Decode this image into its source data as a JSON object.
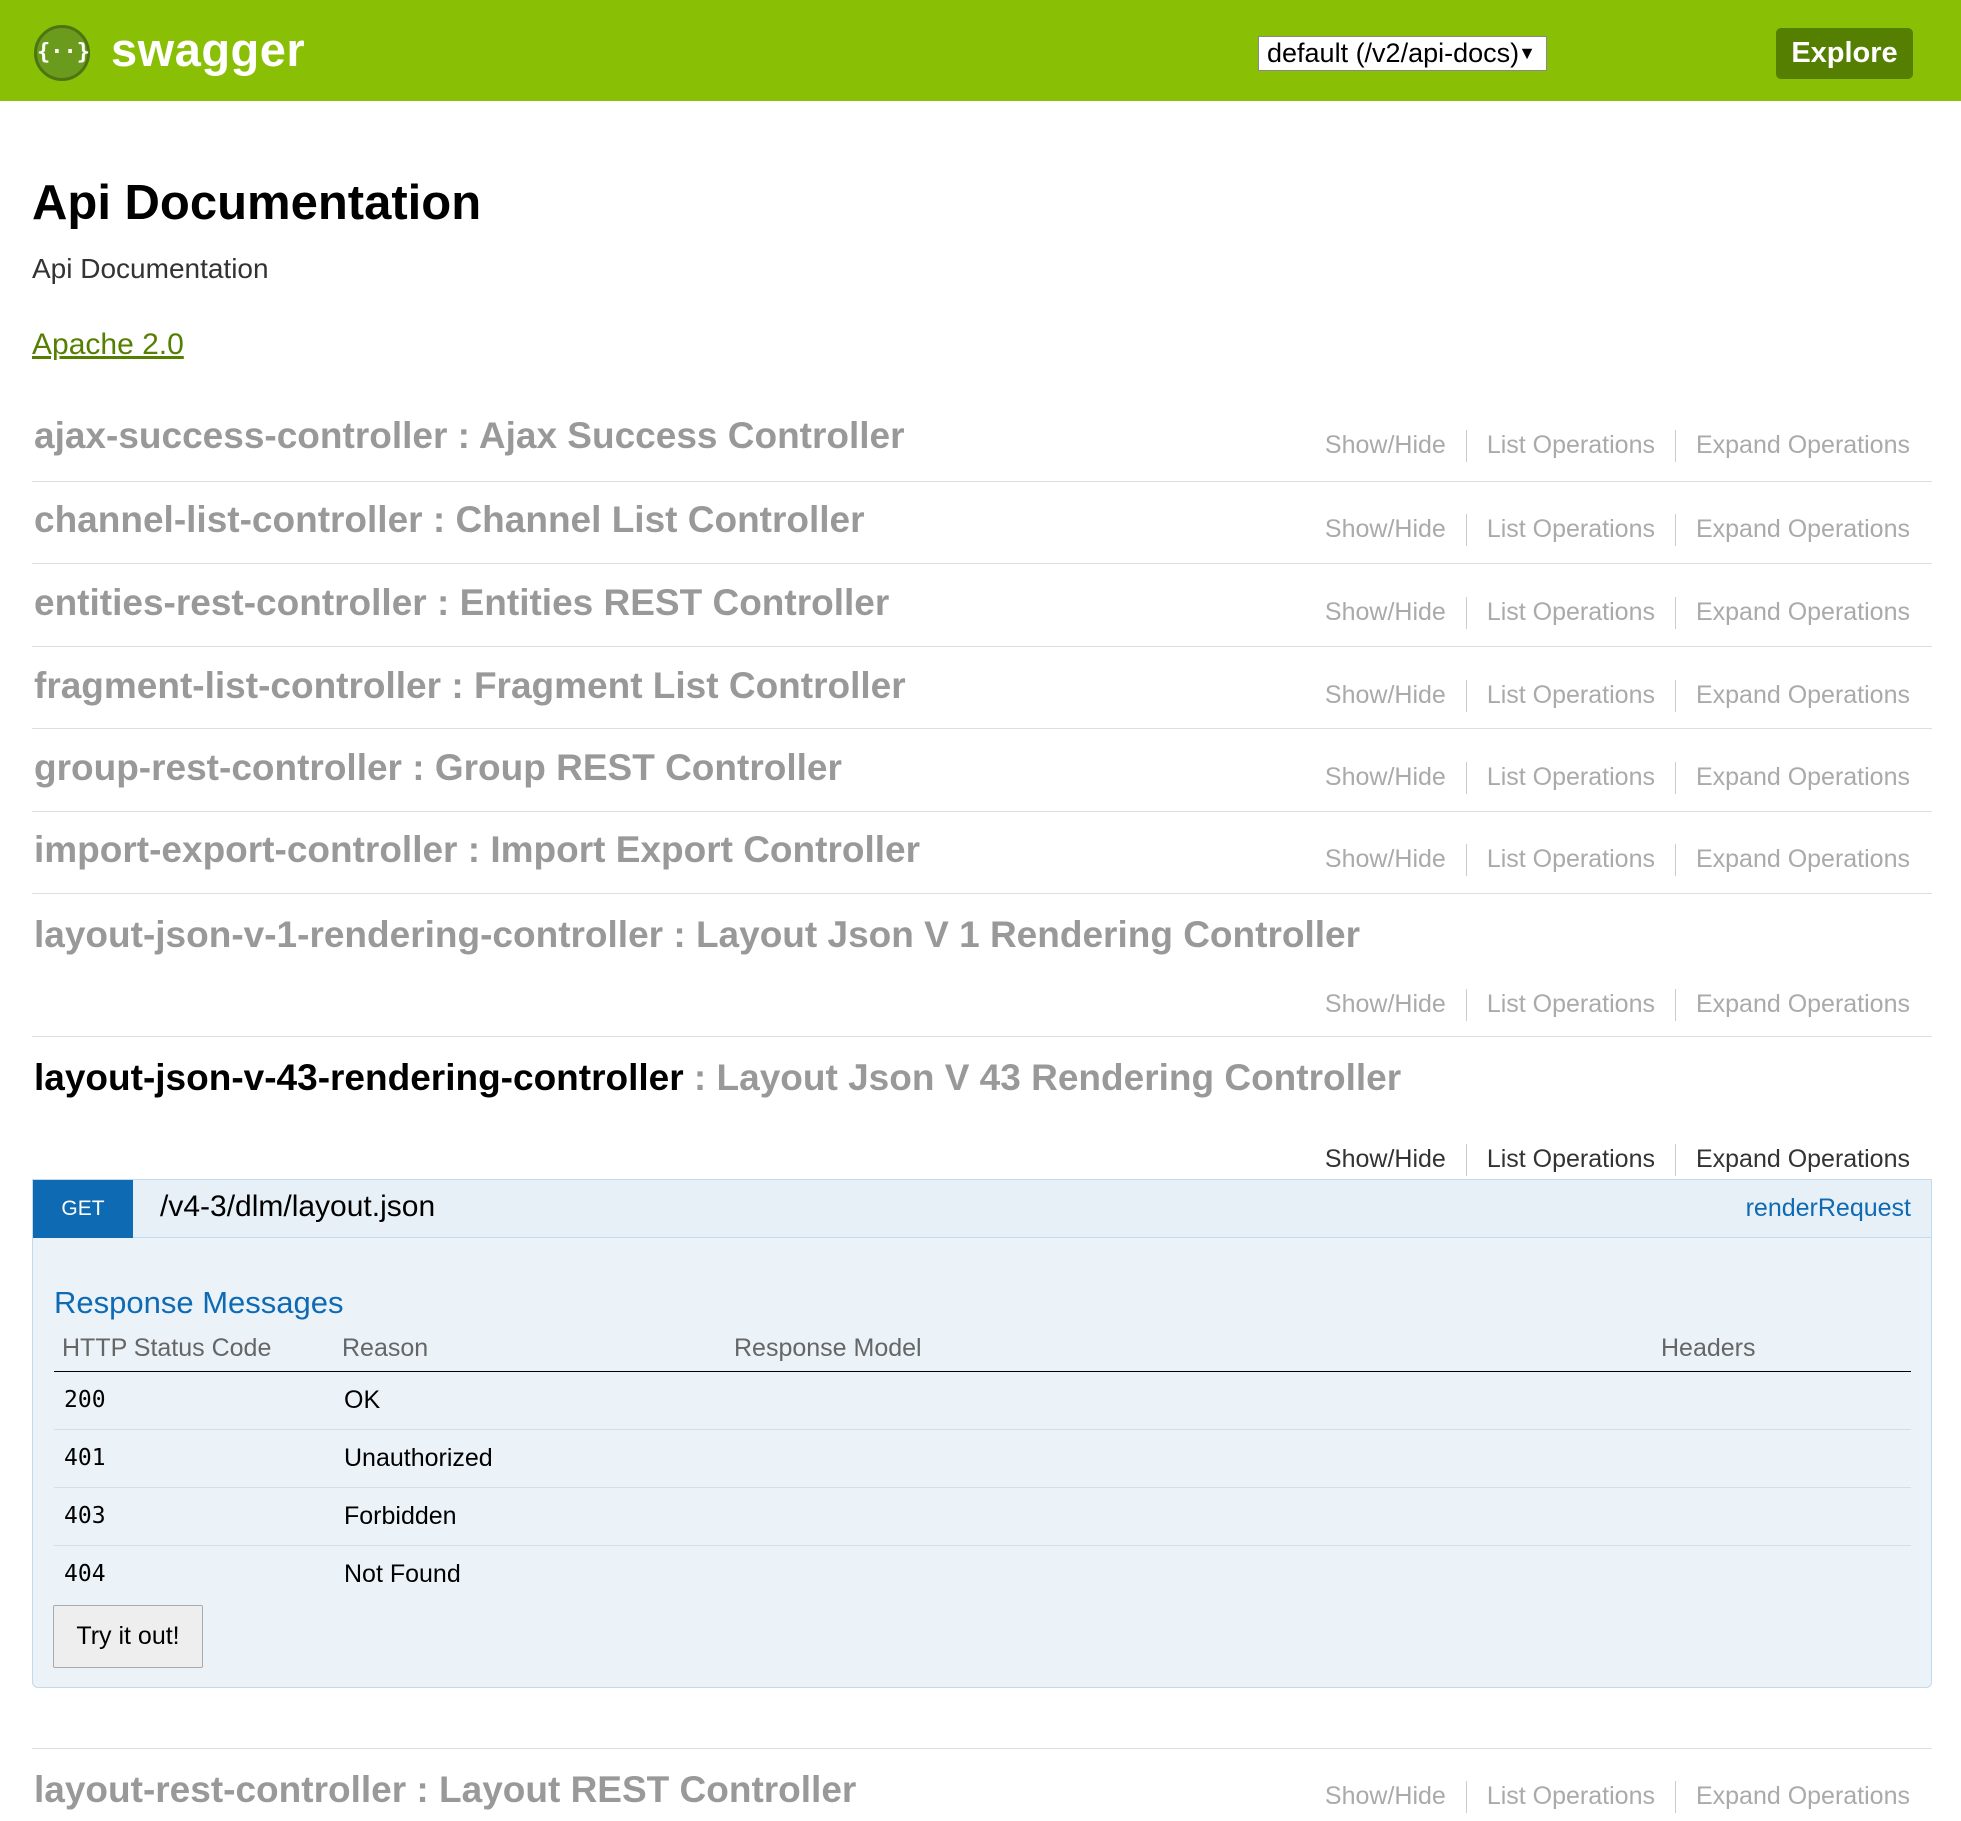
{
  "header": {
    "logo_glyph": "{··}",
    "logo_text": "swagger",
    "spec_select": "default (/v2/api-docs)",
    "spec_caret": "▼",
    "explore_label": "Explore",
    "bg_color": "#89bf04"
  },
  "info": {
    "title": "Api Documentation",
    "description": "Api Documentation",
    "license": "Apache 2.0"
  },
  "ops_labels": {
    "show_hide": "Show/Hide",
    "list_operations": "List Operations",
    "expand_operations": "Expand Operations"
  },
  "resources": [
    {
      "name": "ajax-success-controller",
      "sep": " : ",
      "desc": "Ajax Success Controller"
    },
    {
      "name": "channel-list-controller",
      "sep": " : ",
      "desc": "Channel List Controller"
    },
    {
      "name": "entities-rest-controller",
      "sep": " : ",
      "desc": "Entities REST Controller"
    },
    {
      "name": "fragment-list-controller",
      "sep": " : ",
      "desc": "Fragment List Controller"
    },
    {
      "name": "group-rest-controller",
      "sep": " : ",
      "desc": "Group REST Controller"
    },
    {
      "name": "import-export-controller",
      "sep": " : ",
      "desc": "Import Export Controller"
    },
    {
      "name": "layout-json-v-1-rendering-controller",
      "sep": " : ",
      "desc": "Layout Json V 1 Rendering Controller"
    },
    {
      "name": "layout-json-v-43-rendering-controller",
      "sep": " : ",
      "desc": "Layout Json V 43 Rendering Controller"
    },
    {
      "name": "layout-rest-controller",
      "sep": " : ",
      "desc": "Layout REST Controller"
    }
  ],
  "operation": {
    "method": "GET",
    "path": "/v4-3/dlm/layout.json",
    "nickname": "renderRequest",
    "method_color": "#0f6ab4",
    "response_heading": "Response Messages",
    "columns": [
      "HTTP Status Code",
      "Reason",
      "Response Model",
      "Headers"
    ],
    "rows": [
      {
        "code": "200",
        "reason": "OK"
      },
      {
        "code": "401",
        "reason": "Unauthorized"
      },
      {
        "code": "403",
        "reason": "Forbidden"
      },
      {
        "code": "404",
        "reason": "Not Found"
      }
    ],
    "try_label": "Try it out!"
  }
}
